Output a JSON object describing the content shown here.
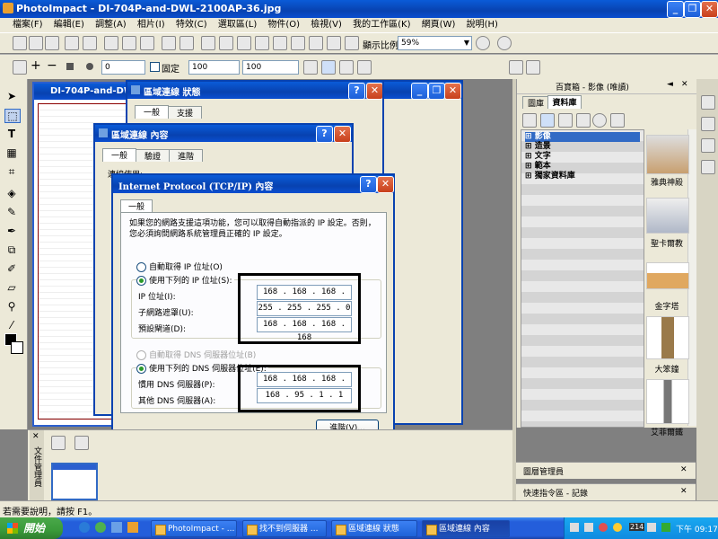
{
  "app": {
    "title": "PhotoImpact - DI-704P-and-DWL-2100AP-36.jpg",
    "menu": [
      "檔案(F)",
      "編輯(E)",
      "調整(A)",
      "相片(I)",
      "特效(C)",
      "選取區(L)",
      "物件(O)",
      "檢視(V)",
      "我的工作區(K)",
      "網頁(W)",
      "說明(H)"
    ],
    "zoom_label": "顯示比例",
    "zoom_value": "59%",
    "tool_field_1": "0",
    "fixed_label": "固定",
    "width_value": "100",
    "height_value": "100"
  },
  "image_window": {
    "title": "DI-704P-and-DWL"
  },
  "status_dialog": {
    "title": "區域連線 狀態",
    "tabs": [
      "一般",
      "支援"
    ]
  },
  "props_dialog": {
    "title": "區域連線 內容",
    "tabs": [
      "一般",
      "驗證",
      "進階"
    ],
    "connect_label": "連線使用:"
  },
  "tcpip_dialog": {
    "title": "Internet Protocol (TCP/IP) 內容",
    "tab": "一般",
    "description": "如果您的網路支援這項功能，您可以取得自動指派的 IP 設定。否則，您必須詢問網路系統管理員正確的 IP 設定。",
    "auto_ip_label": "自動取得 IP 位址(O)",
    "manual_ip_label": "使用下列的 IP 位址(S):",
    "ip_label": "IP 位址(I):",
    "ip_value": "168 . 168 . 168 . 167",
    "mask_label": "子網路遮罩(U):",
    "mask_value": "255 . 255 . 255 .  0",
    "gateway_label": "預設閘道(D):",
    "gateway_value": "168 . 168 . 168 . 168",
    "auto_dns_label": "自動取得 DNS 伺服器位址(B)",
    "manual_dns_label": "使用下列的 DNS 伺服器位址(E):",
    "pref_dns_label": "慣用 DNS 伺服器(P):",
    "pref_dns_value": "168 . 168 . 168 . 168",
    "alt_dns_label": "其他 DNS 伺服器(A):",
    "alt_dns_value": "168 .  95 .  1  .  1",
    "advanced_label": "進階(V)...",
    "ok_label": "確定",
    "cancel_label": "取消"
  },
  "right_panel": {
    "title": "百寶箱 - 影像 (唯讀)",
    "tabs": [
      "圖庫",
      "資料庫"
    ],
    "tree": [
      "影像",
      "造景",
      "文字",
      "範本",
      "獨家資料庫"
    ],
    "thumbs": [
      "雅典神殿",
      "聖卡爾教",
      "金字塔",
      "大笨鐘",
      "艾菲爾鐵"
    ],
    "layer_manager": "圖層管理員",
    "quick_cmd": "快速指令區 - 記錄"
  },
  "left_bottom_panel": {
    "label": "文件管理員"
  },
  "status_bar": {
    "text": "若需要說明，請按 F1。"
  },
  "taskbar": {
    "start": "開始",
    "items": [
      "PhotoImpact - ...",
      "找不到伺服器 ...",
      "區域連線 狀態",
      "區域連線 內容"
    ],
    "tray_badge": "214",
    "clock": "下午 09:17"
  },
  "colors": {
    "xp_blue": "#0842b0",
    "dialog_bg": "#ece9d8",
    "taskbar": "#245edb",
    "start_green": "#3a9a3a"
  }
}
